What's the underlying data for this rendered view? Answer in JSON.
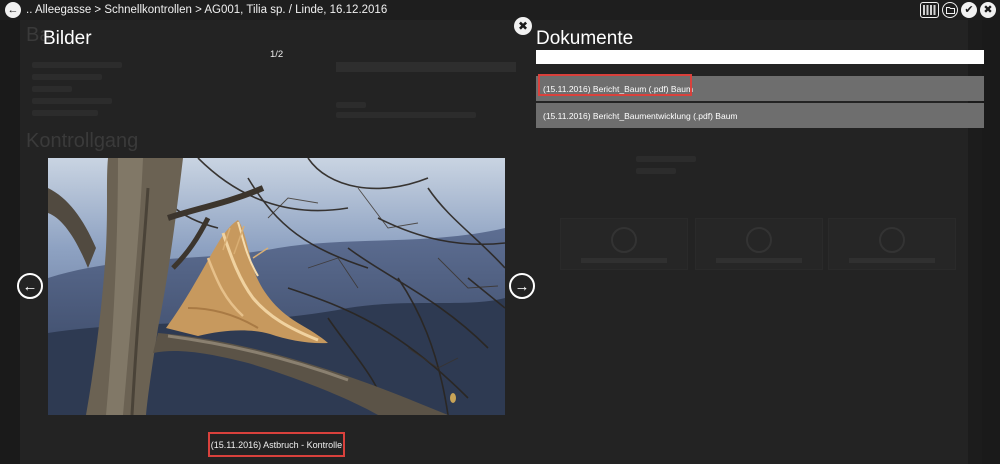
{
  "header": {
    "breadcrumb": ".. Alleegasse > Schnellkontrollen > AG001, Tilia sp. / Linde, 16.12.2016",
    "back_icon": "arrow-left-icon",
    "toolbar_icons": [
      "keyboard-icon",
      "folder-icon",
      "check-icon",
      "close-icon"
    ]
  },
  "background_form": {
    "heading_1": "Ba",
    "heading_2": "Kontrollgang"
  },
  "images_panel": {
    "title": "Bilder",
    "counter": "1/2",
    "photo_caption": "(15.11.2016) Astbruch - Kontrolle",
    "prev_icon": "arrow-left-circle-icon",
    "next_icon": "arrow-right-circle-icon",
    "close_icon": "close-circle-icon"
  },
  "documents_panel": {
    "title": "Dokumente",
    "filter_value": "",
    "items": [
      {
        "label": "(15.11.2016) Bericht_Baum (.pdf) Baum"
      },
      {
        "label": "(15.11.2016) Bericht_Baumentwicklung (.pdf) Baum"
      }
    ]
  },
  "colors": {
    "background": "#1a1a1a",
    "doc_row": "#6e6e6e",
    "highlight": "#d9413c"
  }
}
